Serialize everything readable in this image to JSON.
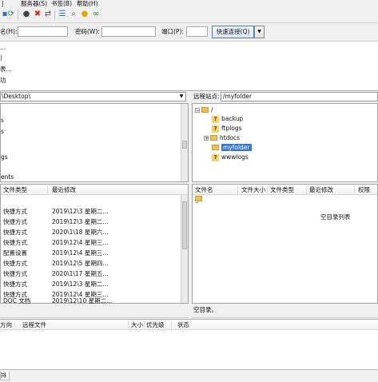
{
  "menubar": {
    "items": [
      "服务器(S)",
      "书签(B)",
      "帮助(H)"
    ]
  },
  "toolbar": {
    "icons": [
      "site-manager-icon",
      "refresh-icon",
      "process-queue-icon",
      "cancel-icon",
      "disconnect-icon",
      "reconnect-icon",
      "filter-icon",
      "search-icon",
      "compare-icon",
      "binoculars-icon"
    ]
  },
  "quickconnect": {
    "host_label": "名(H):",
    "password_label": "密码(W):",
    "port_label": "端口(P):",
    "connect_label": "快速连接(Q)",
    "host_value": "",
    "password_value": "",
    "port_value": ""
  },
  "log": {
    "lines": [
      "...",
      ")",
      "表...",
      "功"
    ]
  },
  "local": {
    "path": "\\Desktop\\",
    "tree_items": [
      "s",
      "s",
      "",
      "gs",
      "",
      "ents"
    ],
    "headers": {
      "type": "文件类型",
      "modified": "最近修改"
    },
    "rows": [
      {
        "type": "",
        "modified": ""
      },
      {
        "type": "快捷方式",
        "modified": "2019\\12\\3 星期二..."
      },
      {
        "type": "快捷方式",
        "modified": "2019\\12\\3 星期二..."
      },
      {
        "type": "快捷方式",
        "modified": "2020\\1\\18 星期六..."
      },
      {
        "type": "快捷方式",
        "modified": "2019\\12\\4 星期三..."
      },
      {
        "type": "配置设置",
        "modified": "2019\\12\\4 星期三..."
      },
      {
        "type": "快捷方式",
        "modified": "2019\\12\\5 星期四..."
      },
      {
        "type": "快捷方式",
        "modified": "2020\\1\\17 星期五..."
      },
      {
        "type": "快捷方式",
        "modified": "2019\\12\\3 星期二..."
      },
      {
        "type": "快捷方式",
        "modified": "2019\\12\\4 星期三..."
      },
      {
        "type": "DOC 文档",
        "modified": "2019\\12\\10 星期二..."
      }
    ]
  },
  "remote": {
    "site_label": "远程站点:",
    "path": "/myfolder",
    "tree": {
      "root": "/",
      "folders": [
        "backup",
        "ftplogs",
        "htdocs",
        "myfolder",
        "wwwlogs"
      ],
      "selected": "myfolder"
    },
    "headers": {
      "name": "文件名",
      "size": "文件大小",
      "type": "文件类型",
      "modified": "最近修改",
      "perms": "权限"
    },
    "parent_entry": "..",
    "empty_text": "空目录列表",
    "status": "空目录。"
  },
  "queue": {
    "headers": {
      "direction": "方向",
      "remote_file": "远程文件",
      "size": "大小",
      "priority": "优先级",
      "status": "状态"
    }
  },
  "bottom": {
    "tab_label": "排"
  }
}
